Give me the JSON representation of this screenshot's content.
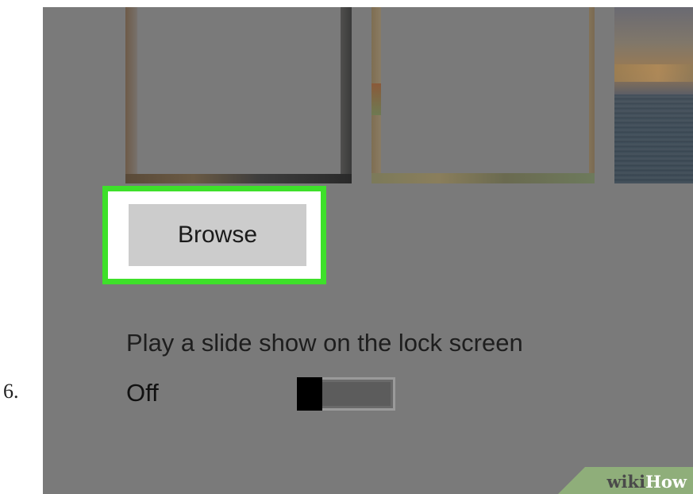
{
  "step": {
    "number": "6."
  },
  "lock_screen": {
    "browse_label": "Browse",
    "slideshow_label": "Play a slide show on the lock screen",
    "toggle_state": "Off",
    "toggle_on": false
  },
  "highlight_color": "#3ee02a",
  "watermark": {
    "wiki": "wiki",
    "how": "How"
  }
}
